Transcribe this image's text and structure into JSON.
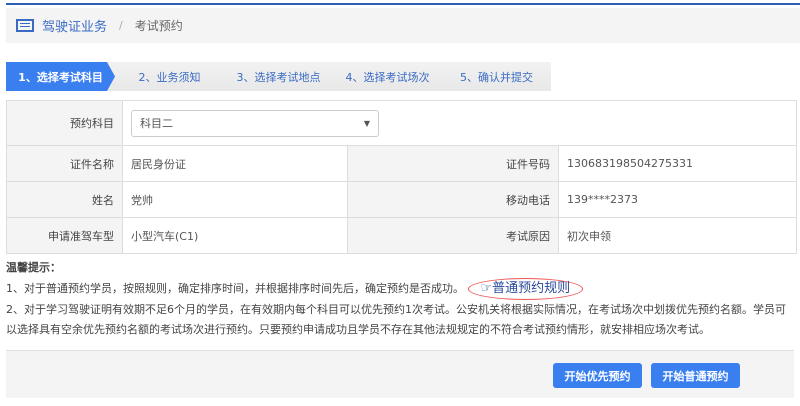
{
  "breadcrumb": {
    "root": "驾驶证业务",
    "separator": "/",
    "current": "考试预约"
  },
  "steps": [
    "1、选择考试科目",
    "2、业务须知",
    "3、选择考试地点",
    "4、选择考试场次",
    "5、确认并提交"
  ],
  "form": {
    "subject_label": "预约科目",
    "subject_value": "科目二",
    "id_type_label": "证件名称",
    "id_type_value": "居民身份证",
    "id_no_label": "证件号码",
    "id_no_value": "130683198504275331",
    "name_label": "姓名",
    "name_value": "党帅",
    "phone_label": "移动电话",
    "phone_value": "139****2373",
    "vehicle_label": "申请准驾车型",
    "vehicle_value": "小型汽车(C1)",
    "reason_label": "考试原因",
    "reason_value": "初次申领"
  },
  "tips": {
    "title": "温馨提示：",
    "line1": "1、对于普通预约学员，按照规则，确定排序时间，并根据排序时间先后，确定预约是否成功。",
    "rule_link": "普通预约规则",
    "line2": "2、对于学习驾驶证明有效期不足6个月的学员，在有效期内每个科目可以优先预约1次考试。公安机关将根据实际情况，在考试场次中划拨优先预约名额。学员可以选择具有空余优先预约名额的考试场次进行预约。只要预约申请成功且学员不存在其他法规规定的不符合考试预约情形，就安排相应场次考试。"
  },
  "buttons": {
    "priority": "开始优先预约",
    "normal": "开始普通预约"
  }
}
